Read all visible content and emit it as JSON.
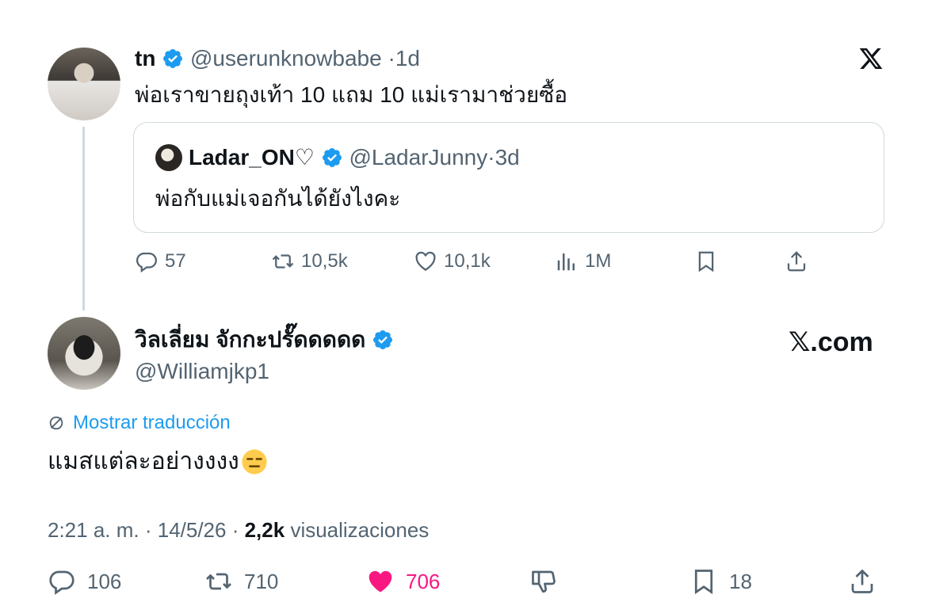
{
  "quoted_thread_tweet": {
    "name": "tn",
    "handle": "@userunknowbabe",
    "time": "1d",
    "text": "พ่อเราขายถุงเท้า 10 แถม 10  แม่เรามาช่วยซื้อ",
    "quote": {
      "name": "Ladar_ON♡",
      "handle": "@LadarJunny",
      "time": "3d",
      "text": "พ่อกับแม่เจอกันได้ยังไงคะ"
    },
    "actions": {
      "replies": "57",
      "reposts": "10,5k",
      "likes": "10,1k",
      "views": "1M"
    }
  },
  "main_tweet": {
    "name": "วิลเลี่ยม จักกะปรั๊ดดดดด",
    "handle": "@Williamjkp1",
    "translate_label": "Mostrar traducción",
    "text": "แมสแต่ละอย่างงงง",
    "time": "2:21 a. m.",
    "date": "14/5/26",
    "views_count": "2,2k",
    "views_label": "visualizaciones",
    "actions": {
      "replies": "106",
      "reposts": "710",
      "likes": "706",
      "bookmarks": "18"
    }
  },
  "watermark": "𝕏.com",
  "colors": {
    "accent": "#1d9bf0",
    "like": "#f91880",
    "muted": "#536471"
  },
  "icons": [
    "x-logo-icon",
    "verified-badge-icon",
    "reply-icon",
    "repost-icon",
    "like-icon",
    "views-icon",
    "bookmark-icon",
    "share-icon",
    "translate-icon",
    "dislike-icon",
    "expressionless-emoji-icon"
  ]
}
